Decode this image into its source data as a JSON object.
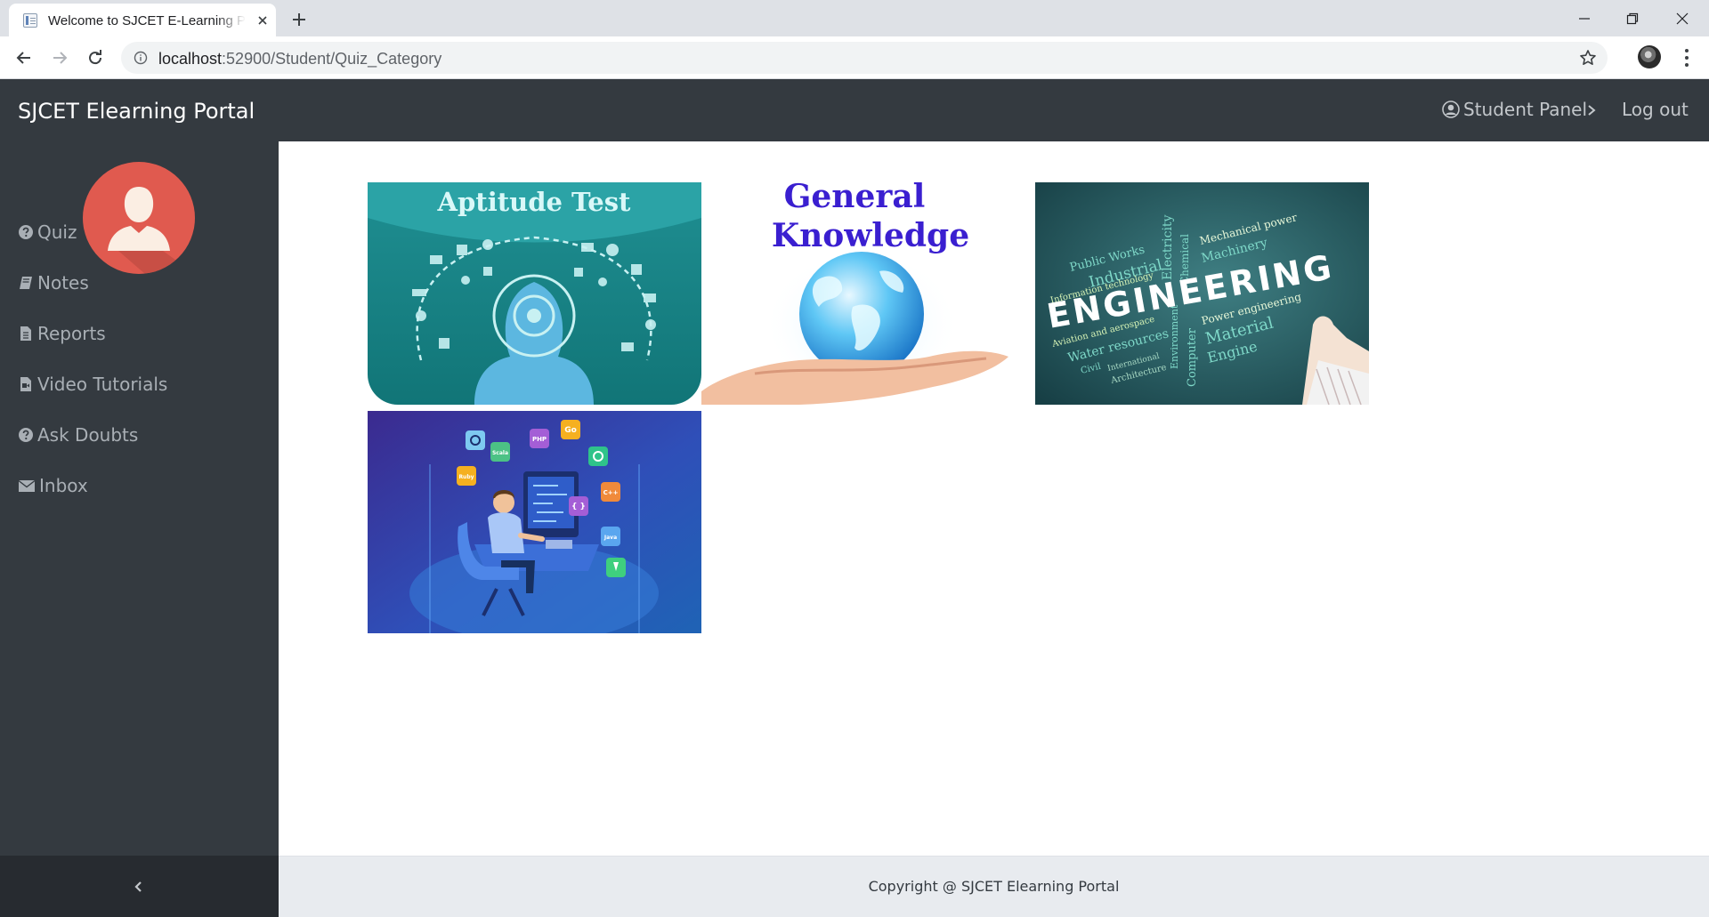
{
  "browser": {
    "tab_title": "Welcome to SJCET E-Learning Portal",
    "url_host": "localhost",
    "url_path": ":52900/Student/Quiz_Category"
  },
  "header": {
    "brand": "SJCET Elearning Portal",
    "student_panel": "Student Panel",
    "logout": "Log out"
  },
  "sidebar": {
    "items": [
      {
        "label": "Quiz",
        "icon": "question-circle-icon"
      },
      {
        "label": "Notes",
        "icon": "book-icon"
      },
      {
        "label": "Reports",
        "icon": "file-text-icon"
      },
      {
        "label": "Video Tutorials",
        "icon": "video-file-icon"
      },
      {
        "label": "Ask Doubts",
        "icon": "question-circle-icon"
      },
      {
        "label": "Inbox",
        "icon": "envelope-icon"
      }
    ]
  },
  "categories": {
    "aptitude": {
      "title": "Aptitude Test"
    },
    "gk": {
      "line1": "General",
      "line2": "Knowledge"
    },
    "engineering": {
      "word": "ENGINEERING",
      "terms": [
        "Public Works",
        "Industrial",
        "Information technology",
        "Aviation and aerospace",
        "Water resources",
        "Civil",
        "International",
        "Architecture",
        "Electricity",
        "Chemical",
        "Mechanical power",
        "Machinery",
        "Environment",
        "Computer",
        "Power engineering",
        "Material",
        "Engine"
      ]
    },
    "programming": {
      "badges": [
        "Scala",
        "PHP",
        "Go",
        "Ruby",
        "C++",
        "Java",
        "{ }"
      ]
    }
  },
  "footer": {
    "copyright": "Copyright @ SJCET Elearning Portal"
  },
  "colors": {
    "header_bg": "#343a40",
    "sidebar_bg": "#343a40",
    "avatar_bg": "#e05a4f",
    "footer_bg": "#e8ebef"
  }
}
